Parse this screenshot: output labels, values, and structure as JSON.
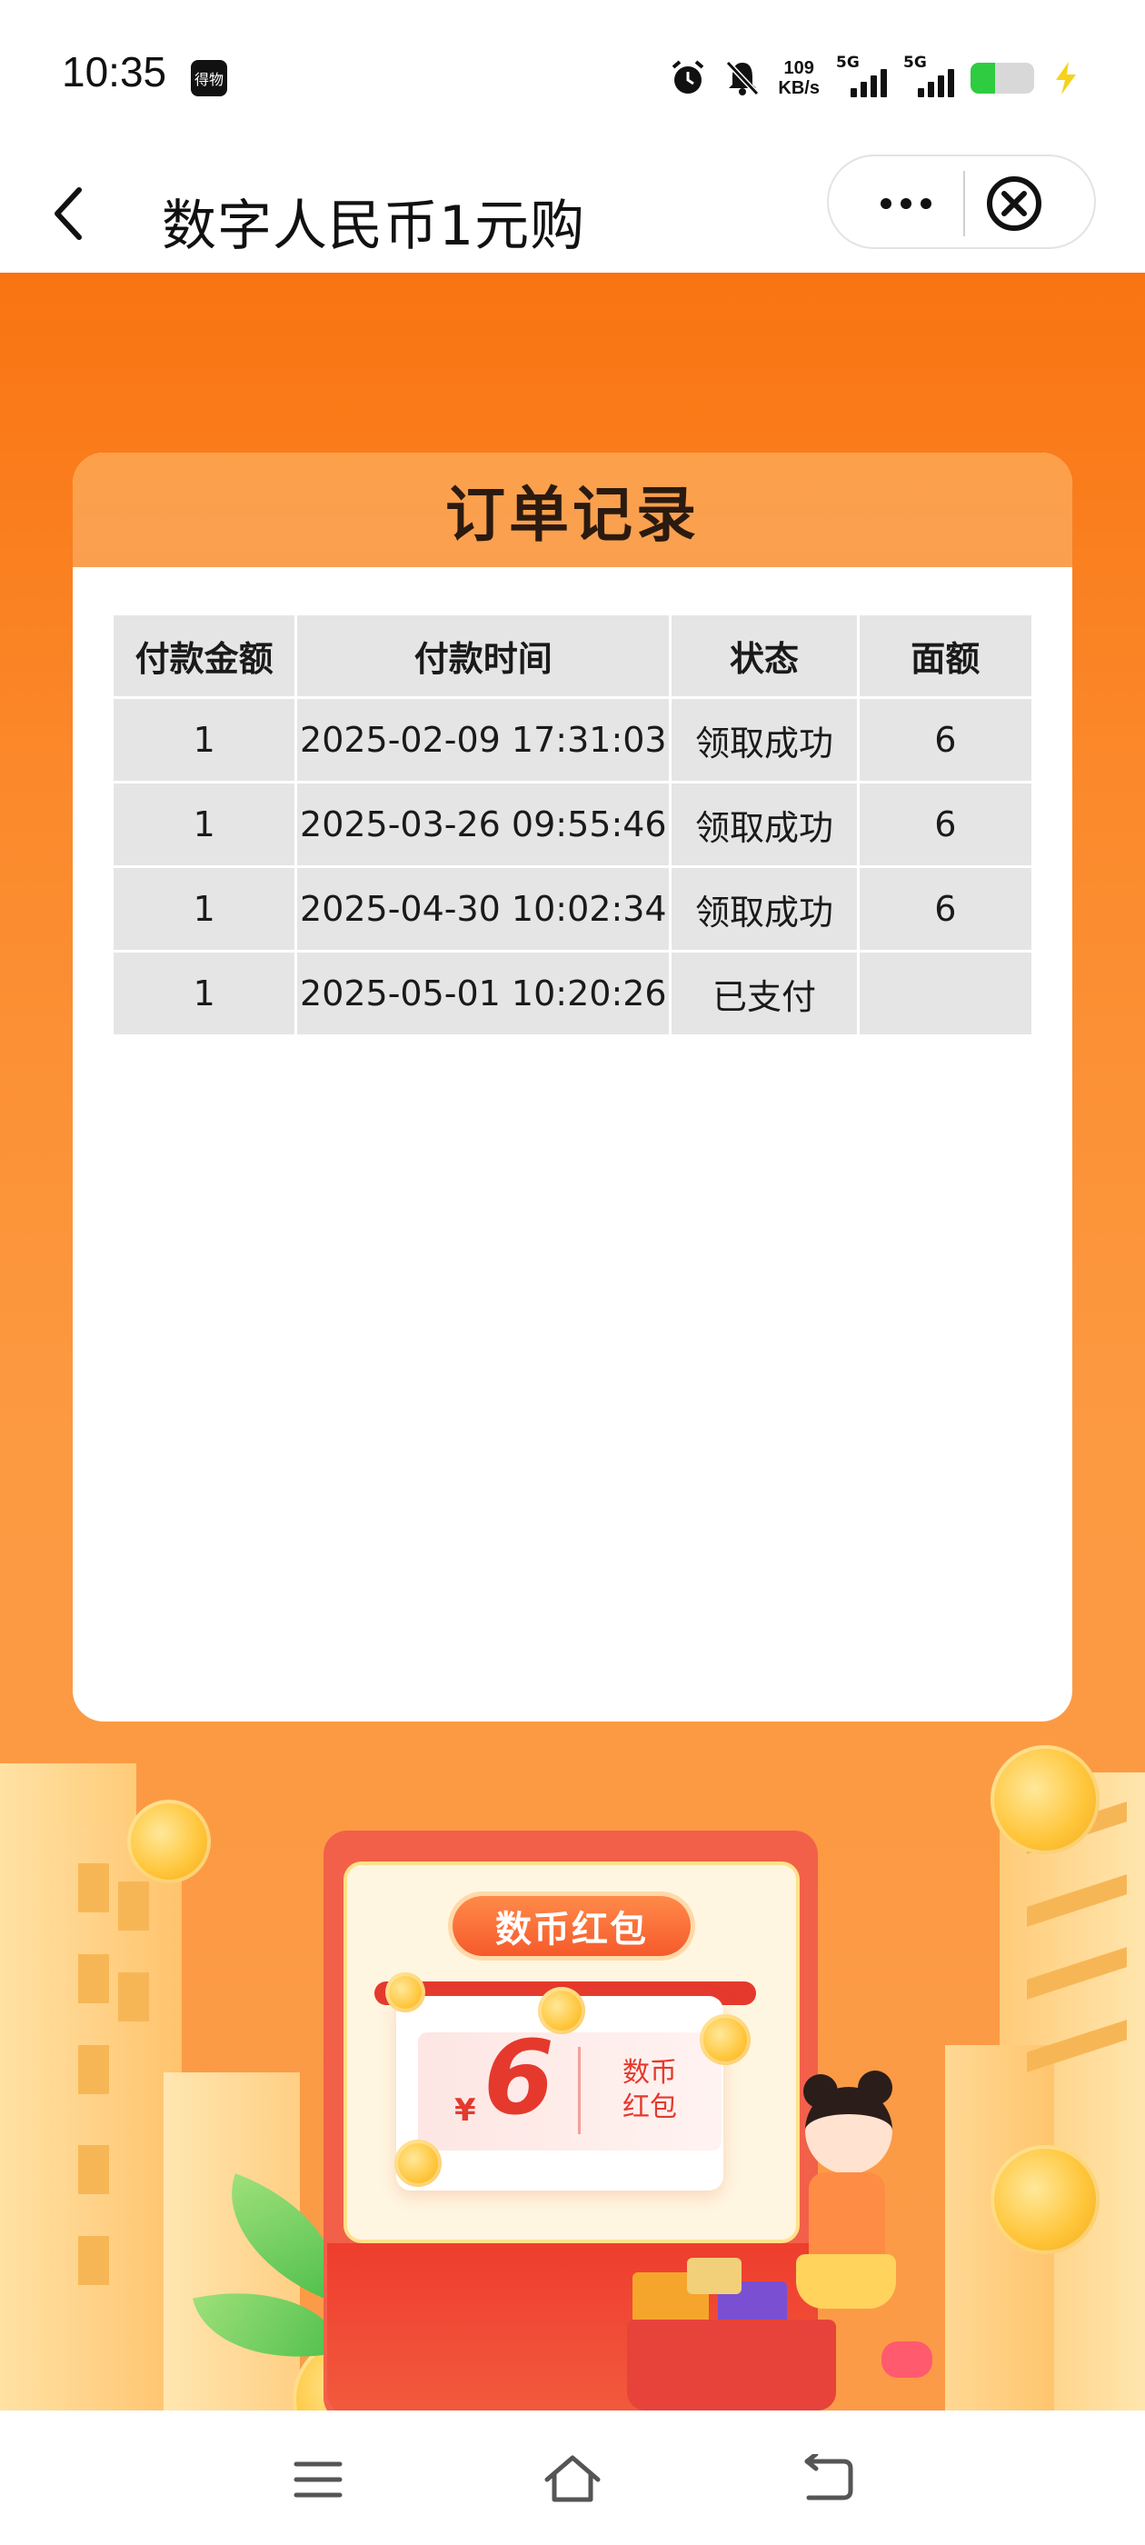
{
  "status_bar": {
    "time": "10:35",
    "app_badge": "得物",
    "speed_value": "109",
    "speed_unit": "KB/s",
    "sim1_label": "5G",
    "sim2_label": "5G",
    "battery_level": 0.38,
    "battery_color": "#2ecc40"
  },
  "nav": {
    "title": "数字人民币1元购",
    "back_icon": "chevron-left-icon",
    "more_icon": "more-dots-icon",
    "close_icon": "close-circle-icon"
  },
  "card": {
    "title": "订单记录"
  },
  "orders": {
    "headers": [
      "付款金额",
      "付款时间",
      "状态",
      "面额"
    ],
    "rows": [
      {
        "amount": "1",
        "time": "2025-02-09 17:31:03",
        "status": "领取成功",
        "face_value": "6"
      },
      {
        "amount": "1",
        "time": "2025-03-26 09:55:46",
        "status": "领取成功",
        "face_value": "6"
      },
      {
        "amount": "1",
        "time": "2025-04-30 10:02:34",
        "status": "领取成功",
        "face_value": "6"
      },
      {
        "amount": "1",
        "time": "2025-05-01 10:20:26",
        "status": "已支付",
        "face_value": ""
      }
    ]
  },
  "promo": {
    "badge": "数币红包",
    "currency": "¥",
    "value": "6",
    "label_line1": "数币",
    "label_line2": "红包"
  },
  "colors": {
    "accent_orange": "#f97412",
    "red_packet": "#f2604a",
    "highlight_red": "#e5392d"
  },
  "system_nav": {
    "menu_icon": "menu-icon",
    "home_icon": "home-icon",
    "back_icon": "back-icon"
  }
}
